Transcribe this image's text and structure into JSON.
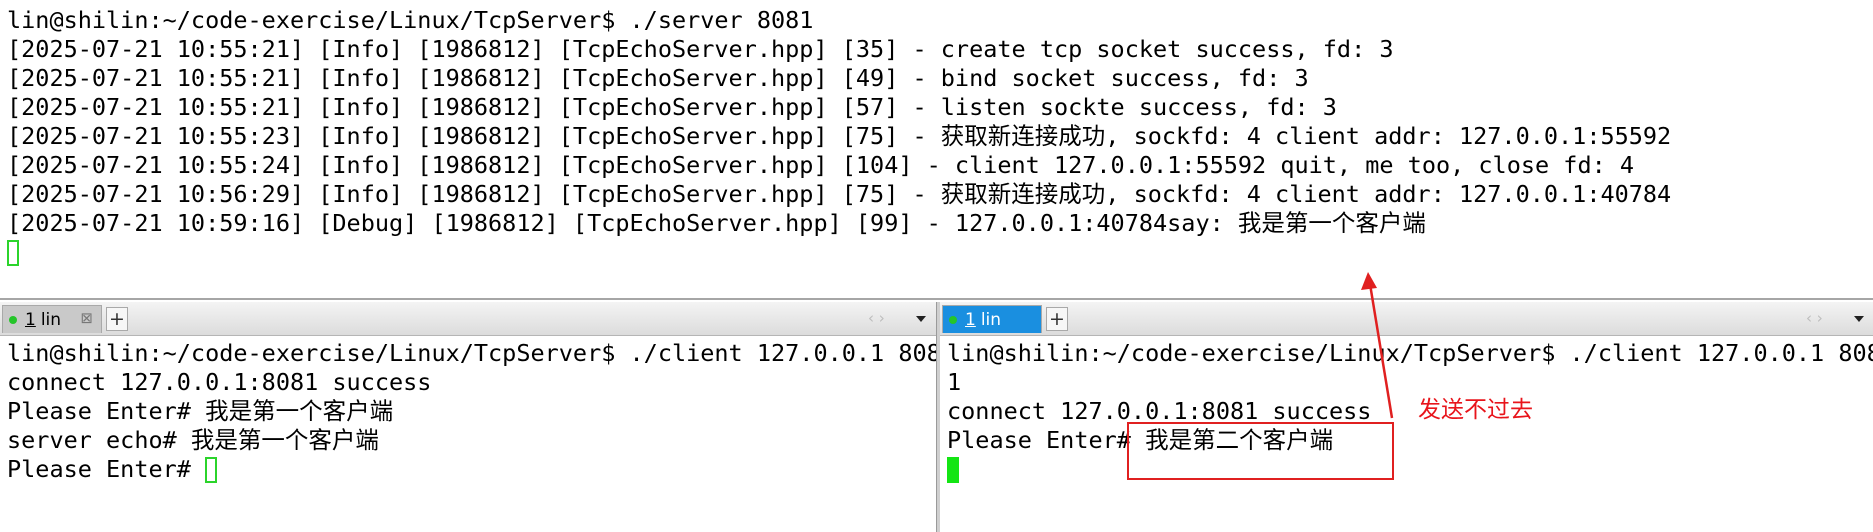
{
  "top_terminal": {
    "lines": [
      "lin@shilin:~/code-exercise/Linux/TcpServer$ ./server 8081",
      "[2025-07-21 10:55:21] [Info] [1986812] [TcpEchoServer.hpp] [35] - create tcp socket success, fd: 3",
      "[2025-07-21 10:55:21] [Info] [1986812] [TcpEchoServer.hpp] [49] - bind socket success, fd: 3",
      "[2025-07-21 10:55:21] [Info] [1986812] [TcpEchoServer.hpp] [57] - listen sockte success, fd: 3",
      "[2025-07-21 10:55:23] [Info] [1986812] [TcpEchoServer.hpp] [75] - 获取新连接成功, sockfd: 4 client addr: 127.0.0.1:55592",
      "[2025-07-21 10:55:24] [Info] [1986812] [TcpEchoServer.hpp] [104] - client 127.0.0.1:55592 quit, me too, close fd: 4",
      "[2025-07-21 10:56:29] [Info] [1986812] [TcpEchoServer.hpp] [75] - 获取新连接成功, sockfd: 4 client addr: 127.0.0.1:40784",
      "[2025-07-21 10:59:16] [Debug] [1986812] [TcpEchoServer.hpp] [99] - 127.0.0.1:40784say: 我是第一个客户端"
    ]
  },
  "left_pane": {
    "tab": {
      "number": "1",
      "label": "lin",
      "close_glyph": "⊠"
    },
    "add_tab_glyph": "+",
    "nav_glyphs": "‹ ›",
    "lines": [
      "lin@shilin:~/code-exercise/Linux/TcpServer$ ./client 127.0.0.1 808",
      "connect 127.0.0.1:8081 success",
      "Please Enter# 我是第一个客户端",
      "server echo# 我是第一个客户端",
      "Please Enter# "
    ]
  },
  "right_pane": {
    "tab": {
      "number": "1",
      "label": "lin"
    },
    "add_tab_glyph": "+",
    "nav_glyphs": "‹ ›",
    "lines": [
      "lin@shilin:~/code-exercise/Linux/TcpServer$ ./client 127.0.0.1 808",
      "1",
      "connect 127.0.0.1:8081 success",
      "Please Enter# 我是第二个客户端",
      ""
    ]
  },
  "annotation": {
    "text": "发送不过去",
    "color": "#e8141b"
  },
  "colors": {
    "active_tab": "#1a8fe0",
    "inactive_tab": "#c9c9c9",
    "cursor": "#14e514",
    "status_dot": "#25c52a"
  }
}
